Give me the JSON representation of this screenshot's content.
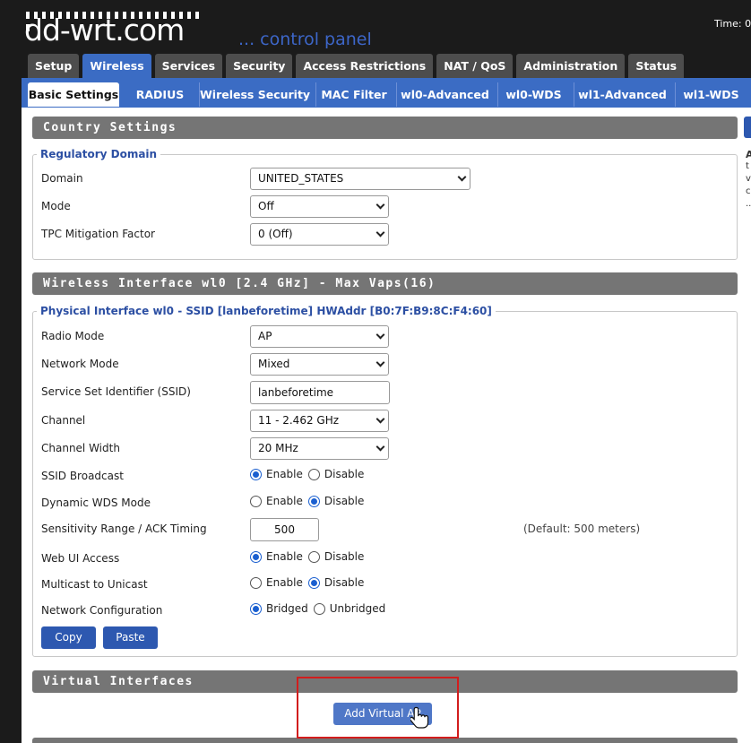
{
  "header": {
    "logo_text": "dd-wrt.com",
    "tagline": "... control panel",
    "time_label": "Time: 0"
  },
  "main_tabs": [
    {
      "label": "Setup",
      "active": false
    },
    {
      "label": "Wireless",
      "active": true
    },
    {
      "label": "Services",
      "active": false
    },
    {
      "label": "Security",
      "active": false
    },
    {
      "label": "Access Restrictions",
      "active": false
    },
    {
      "label": "NAT / QoS",
      "active": false
    },
    {
      "label": "Administration",
      "active": false
    },
    {
      "label": "Status",
      "active": false
    }
  ],
  "sub_tabs": [
    {
      "label": "Basic Settings",
      "active": true
    },
    {
      "label": "RADIUS",
      "active": false
    },
    {
      "label": "Wireless Security",
      "active": false
    },
    {
      "label": "MAC Filter",
      "active": false
    },
    {
      "label": "wl0-Advanced",
      "active": false
    },
    {
      "label": "wl0-WDS",
      "active": false
    },
    {
      "label": "wl1-Advanced",
      "active": false
    },
    {
      "label": "wl1-WDS",
      "active": false
    }
  ],
  "country": {
    "section_title": "Country Settings",
    "legend": "Regulatory Domain",
    "domain_label": "Domain",
    "domain_value": "UNITED_STATES",
    "mode_label": "Mode",
    "mode_value": "Off",
    "tpc_label": "TPC Mitigation Factor",
    "tpc_value": "0 (Off)"
  },
  "wl0": {
    "section_title": "Wireless Interface wl0 [2.4 GHz] - Max Vaps(16)",
    "legend": "Physical Interface wl0 - SSID [lanbeforetime] HWAddr [B0:7F:B9:8C:F4:60]",
    "radio_mode_label": "Radio Mode",
    "radio_mode_value": "AP",
    "network_mode_label": "Network Mode",
    "network_mode_value": "Mixed",
    "ssid_label": "Service Set Identifier (SSID)",
    "ssid_value": "lanbeforetime",
    "channel_label": "Channel",
    "channel_value": "11 - 2.462 GHz",
    "channel_width_label": "Channel Width",
    "channel_width_value": "20 MHz",
    "ssid_broadcast_label": "SSID Broadcast",
    "dynamic_wds_label": "Dynamic WDS Mode",
    "sensitivity_label": "Sensitivity Range / ACK Timing",
    "sensitivity_value": "500",
    "sensitivity_default": "(Default: 500 meters)",
    "webui_label": "Web UI Access",
    "multicast_label": "Multicast to Unicast",
    "netconf_label": "Network Configuration",
    "enable": "Enable",
    "disable": "Disable",
    "bridged": "Bridged",
    "unbridged": "Unbridged",
    "copy_button": "Copy",
    "paste_button": "Paste"
  },
  "virtual": {
    "section_title": "Virtual Interfaces",
    "add_button": "Add Virtual AP"
  },
  "side_help": {
    "letter": "A",
    "lines": [
      "t",
      "v",
      "c",
      ".."
    ]
  }
}
